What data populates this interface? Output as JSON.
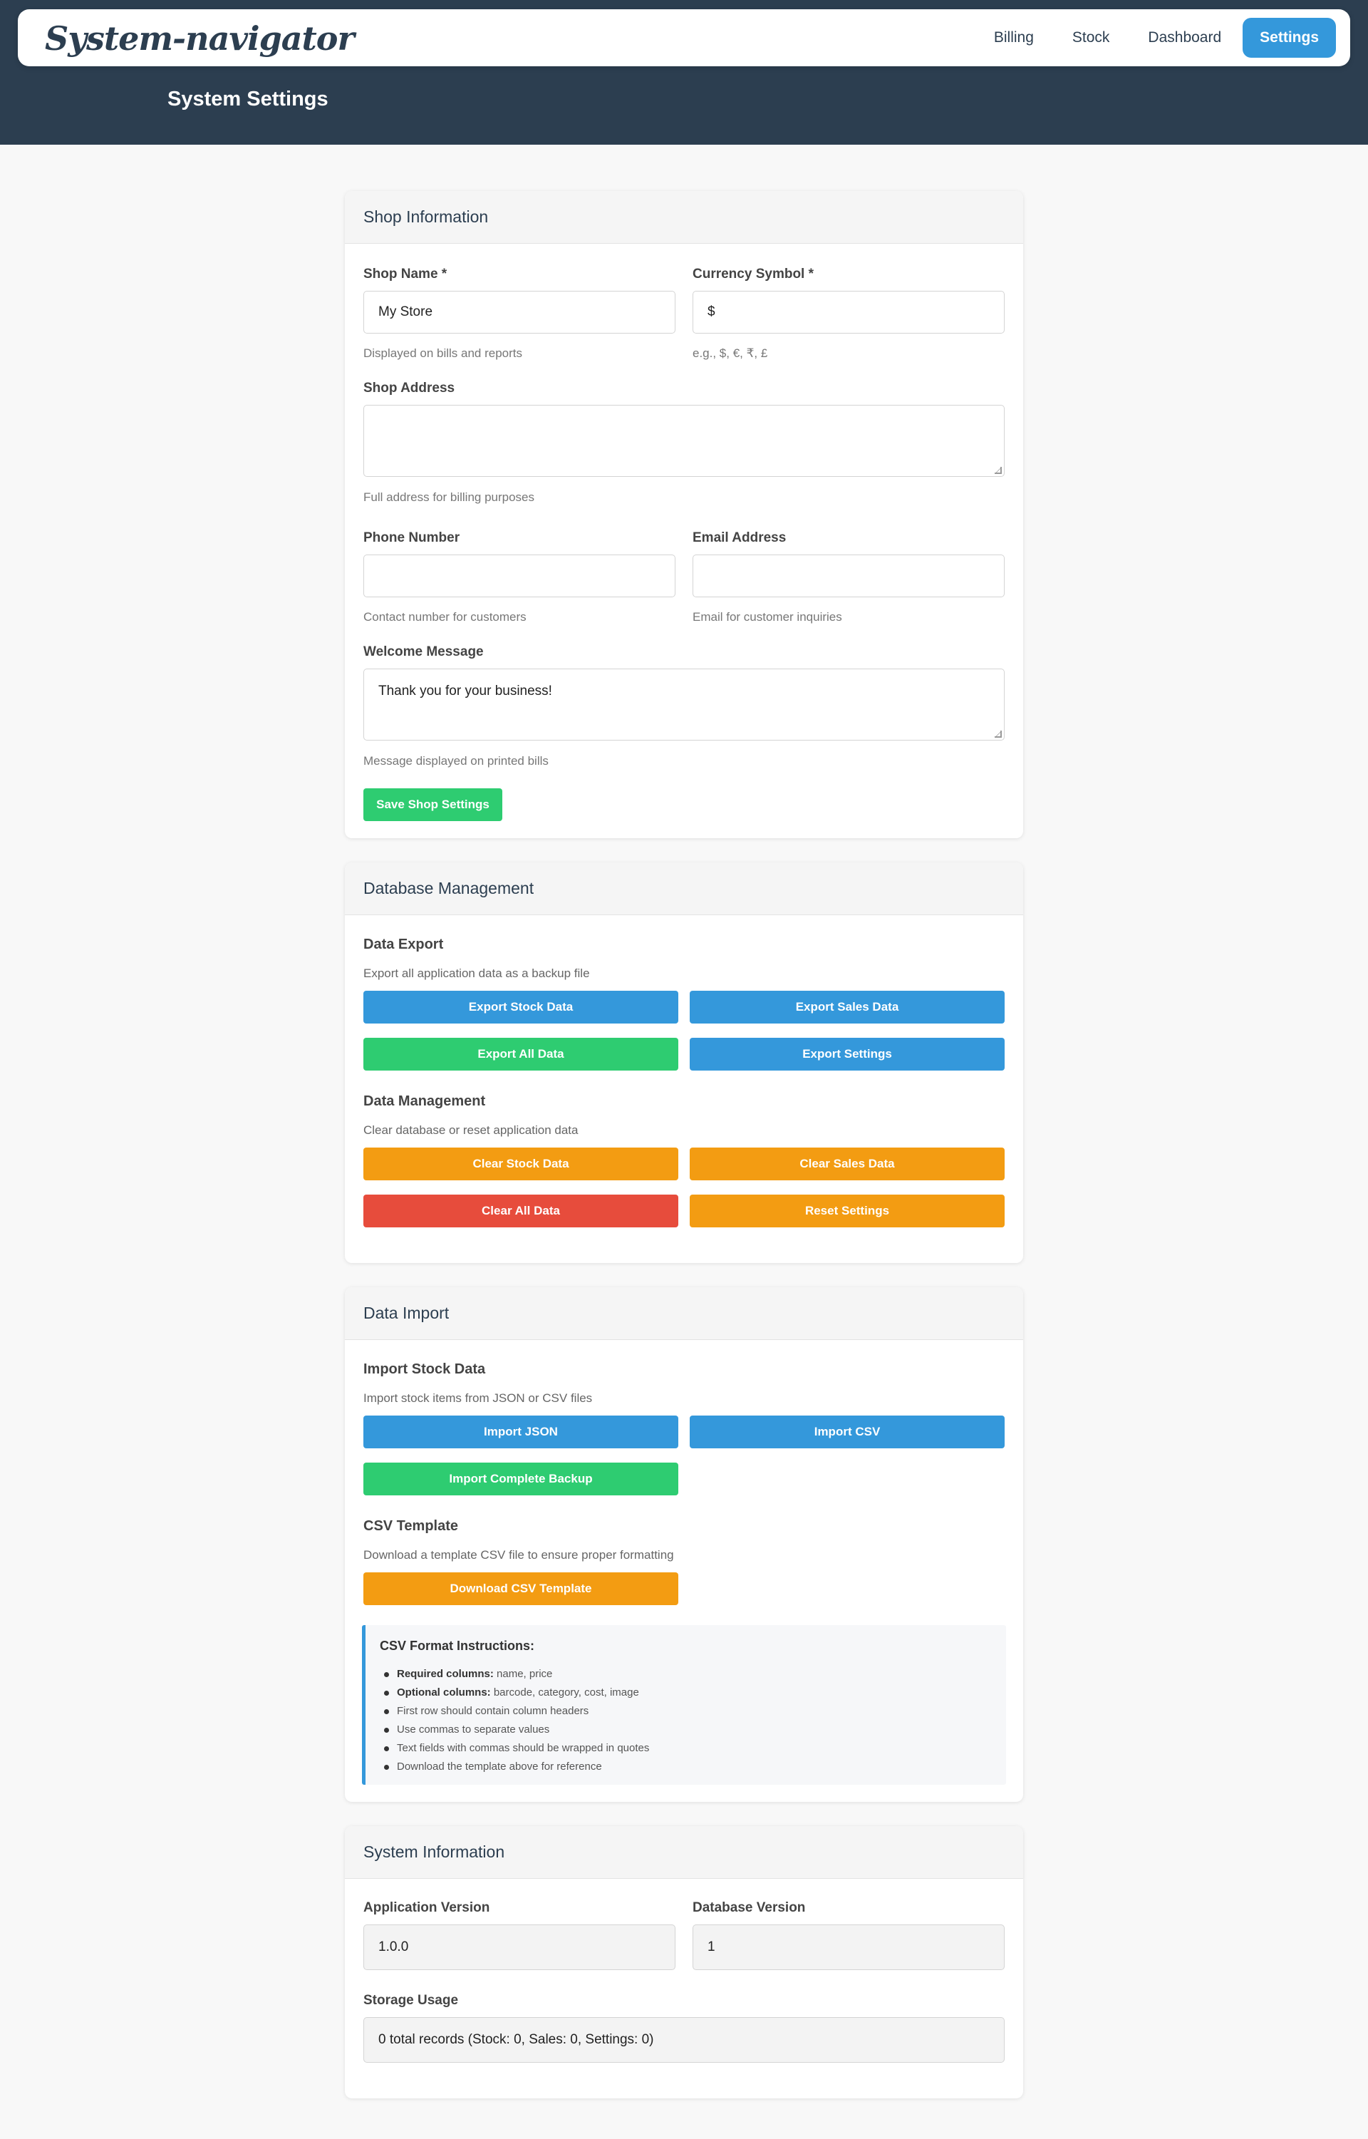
{
  "app": {
    "brand": "System-navigator",
    "page_title": "System Settings"
  },
  "nav": {
    "items": [
      {
        "label": "Billing"
      },
      {
        "label": "Stock"
      },
      {
        "label": "Dashboard"
      },
      {
        "label": "Settings",
        "active": true
      }
    ]
  },
  "colors": {
    "header_bg": "#2c3e50",
    "primary": "#3498db",
    "success": "#2ecc71",
    "warning": "#f39c12",
    "danger": "#e74c3c"
  },
  "shop": {
    "title": "Shop Information",
    "shop_name_label": "Shop Name *",
    "shop_name_value": "My Store",
    "shop_name_help": "Displayed on bills and reports",
    "currency_label": "Currency Symbol *",
    "currency_value": "$",
    "currency_help": "e.g., $, €, ₹, £",
    "address_label": "Shop Address",
    "address_value": "",
    "address_help": "Full address for billing purposes",
    "phone_label": "Phone Number",
    "phone_value": "",
    "phone_help": "Contact number for customers",
    "email_label": "Email Address",
    "email_value": "",
    "email_help": "Email for customer inquiries",
    "welcome_label": "Welcome Message",
    "welcome_value": "Thank you for your business!",
    "welcome_help": "Message displayed on printed bills",
    "save_button": "Save Shop Settings"
  },
  "database": {
    "title": "Database Management",
    "export_title": "Data Export",
    "export_desc": "Export all application data as a backup file",
    "export_stock": "Export Stock Data",
    "export_sales": "Export Sales Data",
    "export_all": "Export All Data",
    "export_settings": "Export Settings",
    "manage_title": "Data Management",
    "manage_desc": "Clear database or reset application data",
    "clear_stock": "Clear Stock Data",
    "clear_sales": "Clear Sales Data",
    "clear_all": "Clear All Data",
    "reset_settings": "Reset Settings"
  },
  "import": {
    "title": "Data Import",
    "stock_title": "Import Stock Data",
    "stock_desc": "Import stock items from JSON or CSV files",
    "import_json": "Import JSON",
    "import_csv": "Import CSV",
    "import_backup": "Import Complete Backup",
    "template_title": "CSV Template",
    "template_desc": "Download a template CSV file to ensure proper formatting",
    "download_template": "Download CSV Template",
    "instructions_title": "CSV Format Instructions:",
    "instructions": [
      {
        "bold": "Required columns:",
        "text": " name, price"
      },
      {
        "bold": "Optional columns:",
        "text": " barcode, category, cost, image"
      },
      {
        "bold": "",
        "text": "First row should contain column headers"
      },
      {
        "bold": "",
        "text": "Use commas to separate values"
      },
      {
        "bold": "",
        "text": "Text fields with commas should be wrapped in quotes"
      },
      {
        "bold": "",
        "text": "Download the template above for reference"
      }
    ]
  },
  "system": {
    "title": "System Information",
    "app_version_label": "Application Version",
    "app_version_value": "1.0.0",
    "db_version_label": "Database Version",
    "db_version_value": "1",
    "storage_label": "Storage Usage",
    "storage_value": "0 total records (Stock: 0, Sales: 0, Settings: 0)"
  }
}
